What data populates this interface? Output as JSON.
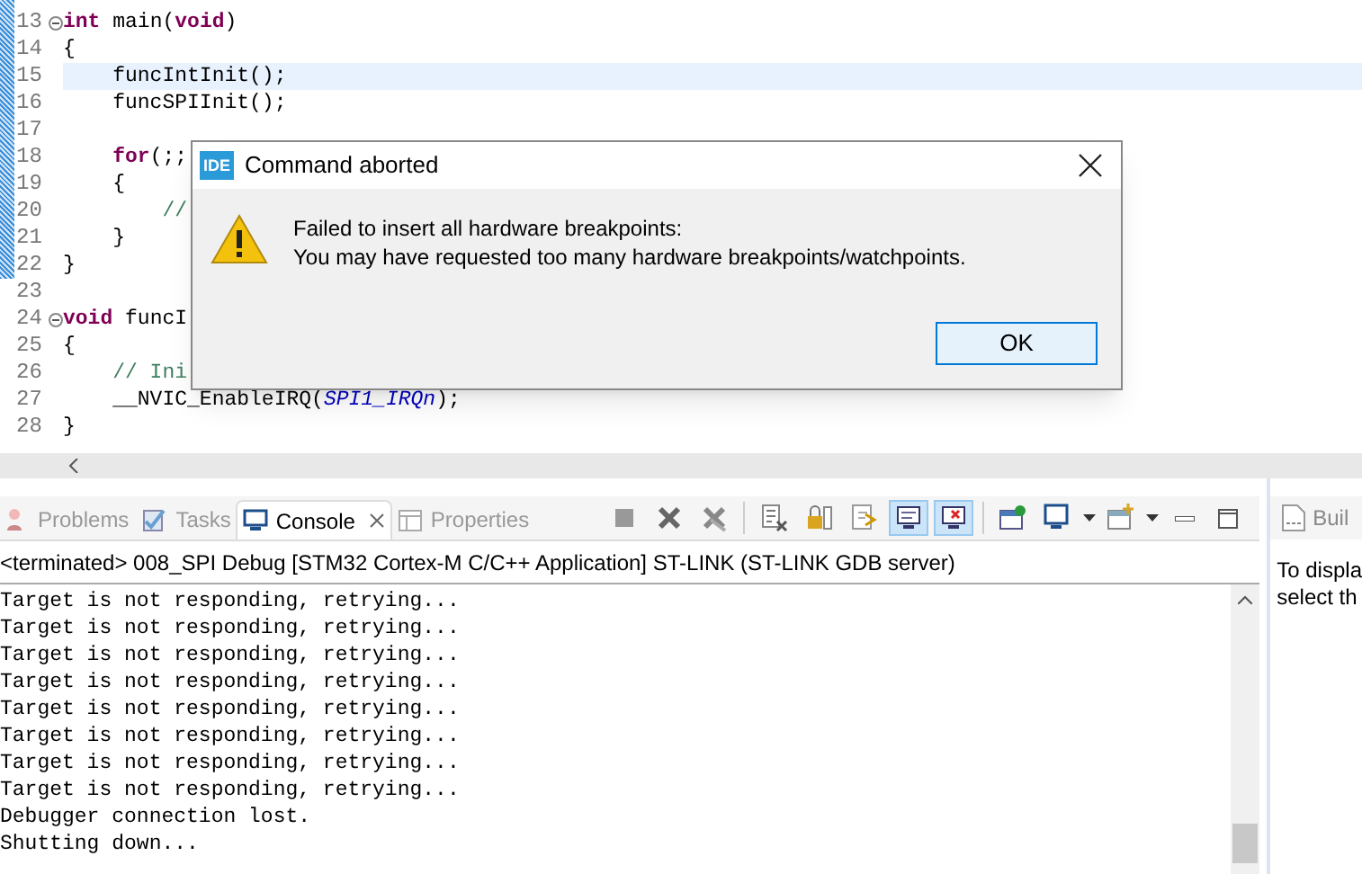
{
  "editor": {
    "lines": [
      {
        "number": "13",
        "fold": true,
        "current": false,
        "tokens": [
          {
            "kind": "keyword",
            "text": "int"
          },
          {
            "kind": "plain",
            "text": " main("
          },
          {
            "kind": "keyword",
            "text": "void"
          },
          {
            "kind": "plain",
            "text": ")"
          }
        ]
      },
      {
        "number": "14",
        "fold": false,
        "current": false,
        "tokens": [
          {
            "kind": "plain",
            "text": "{"
          }
        ]
      },
      {
        "number": "15",
        "fold": false,
        "current": true,
        "tokens": [
          {
            "kind": "plain",
            "text": "    funcIntInit();"
          }
        ]
      },
      {
        "number": "16",
        "fold": false,
        "current": false,
        "tokens": [
          {
            "kind": "plain",
            "text": "    funcSPIInit();"
          }
        ]
      },
      {
        "number": "17",
        "fold": false,
        "current": false
      },
      {
        "number": "18",
        "fold": false,
        "current": false,
        "tokens": [
          {
            "kind": "keyword",
            "text": "    for"
          },
          {
            "kind": "plain",
            "text": "(;;"
          }
        ]
      },
      {
        "number": "19",
        "fold": false,
        "current": false,
        "tokens": [
          {
            "kind": "plain",
            "text": "    {"
          }
        ]
      },
      {
        "number": "20",
        "fold": false,
        "current": false,
        "tokens": [
          {
            "kind": "comment",
            "text": "        //"
          }
        ]
      },
      {
        "number": "21",
        "fold": false,
        "current": false,
        "tokens": [
          {
            "kind": "plain",
            "text": "    }"
          }
        ]
      },
      {
        "number": "22",
        "fold": false,
        "current": false,
        "tokens": [
          {
            "kind": "plain",
            "text": "}"
          }
        ]
      },
      {
        "number": "23",
        "fold": false,
        "current": false
      },
      {
        "number": "24",
        "fold": true,
        "current": false,
        "tokens": [
          {
            "kind": "keyword",
            "text": "void"
          },
          {
            "kind": "plain",
            "text": " funcI"
          }
        ]
      },
      {
        "number": "25",
        "fold": false,
        "current": false,
        "tokens": [
          {
            "kind": "plain",
            "text": "{"
          }
        ]
      },
      {
        "number": "26",
        "fold": false,
        "current": false,
        "tokens": [
          {
            "kind": "comment",
            "text": "    // Ini"
          }
        ]
      },
      {
        "number": "27",
        "fold": false,
        "current": false,
        "tokens": [
          {
            "kind": "plain",
            "text": "    __NVIC_EnableIRQ("
          },
          {
            "kind": "constant",
            "text": "SPI1_IRQn"
          },
          {
            "kind": "plain",
            "text": ");"
          }
        ]
      },
      {
        "number": "28",
        "fold": false,
        "current": false,
        "tokens": [
          {
            "kind": "plain",
            "text": "}"
          }
        ]
      }
    ]
  },
  "dialog": {
    "title": "Command aborted",
    "badge": "IDE",
    "message": [
      "Failed to insert all hardware breakpoints:",
      "You may have requested too many hardware breakpoints/watchpoints."
    ],
    "button": "OK"
  },
  "tabs": [
    {
      "label": "Problems",
      "selected": false
    },
    {
      "label": "Tasks",
      "selected": false
    },
    {
      "label": "Console",
      "selected": true
    },
    {
      "label": "Properties",
      "selected": false
    }
  ],
  "toolbar": [
    {
      "pressed": false
    },
    {
      "pressed": false
    },
    {
      "pressed": false
    },
    {
      "pressed": false
    },
    {
      "pressed": false
    },
    {
      "pressed": false
    },
    {
      "pressed": true
    },
    {
      "pressed": true
    },
    {
      "pressed": false
    },
    {
      "pressed": false
    },
    {
      "pressed": false
    }
  ],
  "console": {
    "header": "<terminated> 008_SPI Debug [STM32 Cortex-M C/C++ Application] ST-LINK (ST-LINK GDB server)",
    "lines": [
      "Target is not responding, retrying...",
      "Target is not responding, retrying...",
      "Target is not responding, retrying...",
      "Target is not responding, retrying...",
      "Target is not responding, retrying...",
      "Target is not responding, retrying...",
      "Target is not responding, retrying...",
      "Target is not responding, retrying...",
      "Debugger connection lost.",
      "Shutting down..."
    ]
  },
  "side_panel": {
    "tab": "Buil",
    "text": [
      "To displa",
      "select th"
    ]
  }
}
